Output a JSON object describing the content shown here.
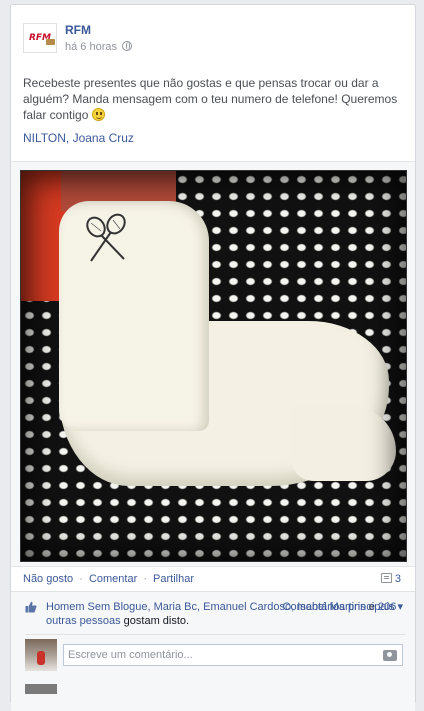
{
  "post": {
    "page_name": "RFM",
    "logo_text": "RFM",
    "timestamp": "há 6 horas",
    "privacy_icon": "globe-icon",
    "text": "Recebeste presentes que não gostas e que pensas trocar ou dar a alguém? Manda mensagem com o teu numero de telefone! Queremos falar contigo",
    "emoji": "smiley-icon",
    "tags": "NILTON, Joana Cruz"
  },
  "actions": {
    "unlike": "Não gosto",
    "comment": "Comentar",
    "share": "Partilhar",
    "separator": "·",
    "comment_count": "3"
  },
  "likes": {
    "names": "Homem Sem Blogue, Maria Bc, Emanuel Cardoso, Isabel Martins",
    "connector": " e ",
    "others": "206 outras pessoas",
    "suffix": " gostam disto.",
    "top_comments_label": "Comentários principais ▾"
  },
  "comment_input": {
    "placeholder": "Escreve um comentário..."
  },
  "colors": {
    "link": "#3b5998",
    "background": "#e9ebee"
  }
}
